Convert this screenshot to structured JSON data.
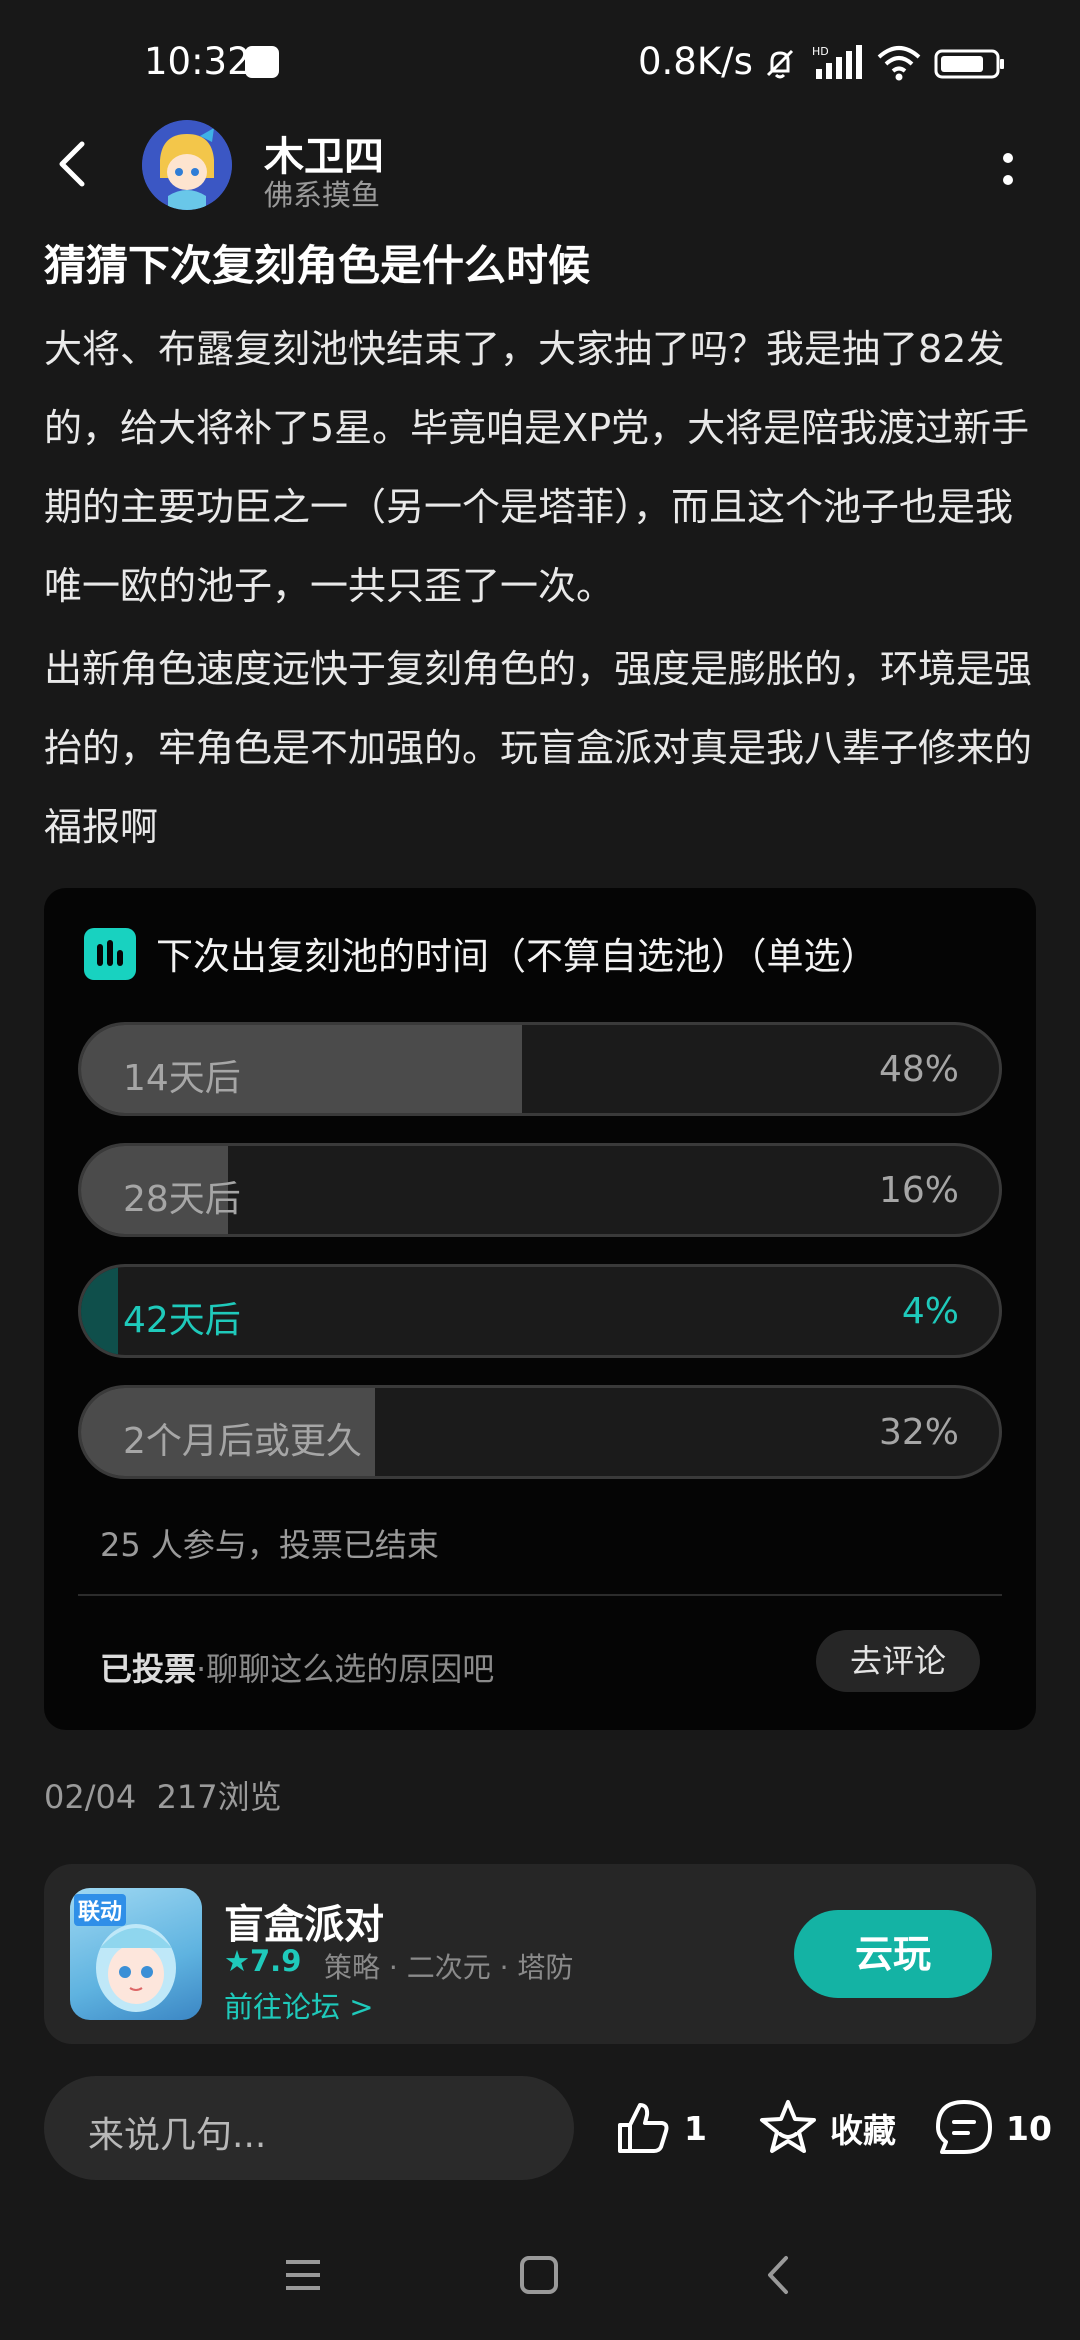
{
  "status_bar": {
    "time": "10:32",
    "net_speed": "0.8K/s"
  },
  "author": {
    "name": "木卫四",
    "tagline": "佛系摸鱼"
  },
  "post": {
    "title": "猜猜下次复刻角色是什么时候",
    "paragraphs": [
      "大将、布露复刻池快结束了，大家抽了吗？我是抽了82发的，给大将补了5星。毕竟咱是XP党，大将是陪我渡过新手期的主要功臣之一（另一个是塔菲），而且这个池子也是我唯一欧的池子，一共只歪了一次。",
      "出新角色速度远快于复刻角色的，强度是膨胀的，环境是强抬的，牢角色是不加强的。玩盲盒派对真是我八辈子修来的福报啊"
    ]
  },
  "poll": {
    "title": "下次出复刻池的时间（不算自选池）（单选）",
    "options": [
      {
        "label": "14天后",
        "percent": "48%",
        "share": 0.48,
        "selected": false
      },
      {
        "label": "28天后",
        "percent": "16%",
        "share": 0.16,
        "selected": false
      },
      {
        "label": "42天后",
        "percent": "4%",
        "share": 0.04,
        "selected": true
      },
      {
        "label": "2个月后或更久",
        "percent": "32%",
        "share": 0.32,
        "selected": false
      }
    ],
    "stats": "25 人参与，投票已结束",
    "voted_label": "已投票",
    "voted_prompt": "·聊聊这么选的原因吧",
    "comment_button": "去评论"
  },
  "meta": {
    "date": "02/04",
    "views": "217浏览"
  },
  "game": {
    "badge": "联动",
    "name": "盲盒派对",
    "rating": "★7.9",
    "tags": "策略 · 二次元 · 塔防",
    "forum_link": "前往论坛 >",
    "play_button": "云玩"
  },
  "bottom_bar": {
    "reply_placeholder": "来说几句...",
    "likes": "1",
    "favorite_label": "收藏",
    "comments": "10"
  },
  "colors": {
    "accent": "#1fcabb",
    "background": "#181818",
    "card": "#050505"
  }
}
